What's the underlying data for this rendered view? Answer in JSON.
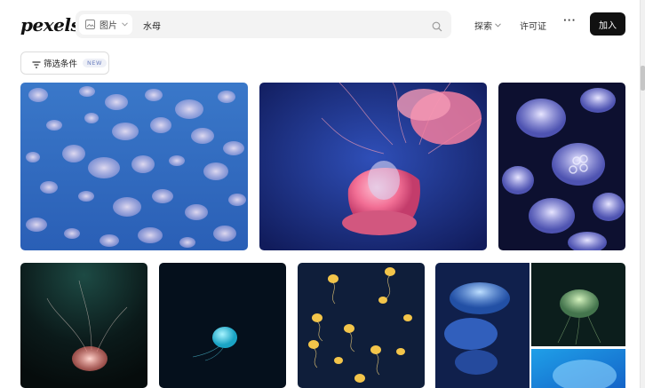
{
  "header": {
    "logo": "pexels",
    "search": {
      "type_label": "图片",
      "query": "水母"
    },
    "nav": {
      "explore": "探索",
      "license": "许可证",
      "more": "···",
      "join": "加入"
    }
  },
  "filters": {
    "label": "筛选条件",
    "badge": "NEW"
  },
  "photos": [
    {
      "icon": "jellyfish-school-blue"
    },
    {
      "icon": "pink-jellyfish"
    },
    {
      "icon": "moon-jellyfish-dark"
    },
    {
      "icon": "glowing-jellyfish-pink"
    },
    {
      "icon": "teal-jellyfish"
    },
    {
      "icon": "yellow-jellyfish-group"
    },
    {
      "icon": "blue-jellyfish-lit"
    },
    {
      "icon": "green-jellyfish"
    },
    {
      "icon": "blue-jellyfish-crop"
    }
  ],
  "colors": {
    "accent": "#111111",
    "badge_text": "#6b7fbf",
    "search_bg": "#f3f3f3"
  }
}
